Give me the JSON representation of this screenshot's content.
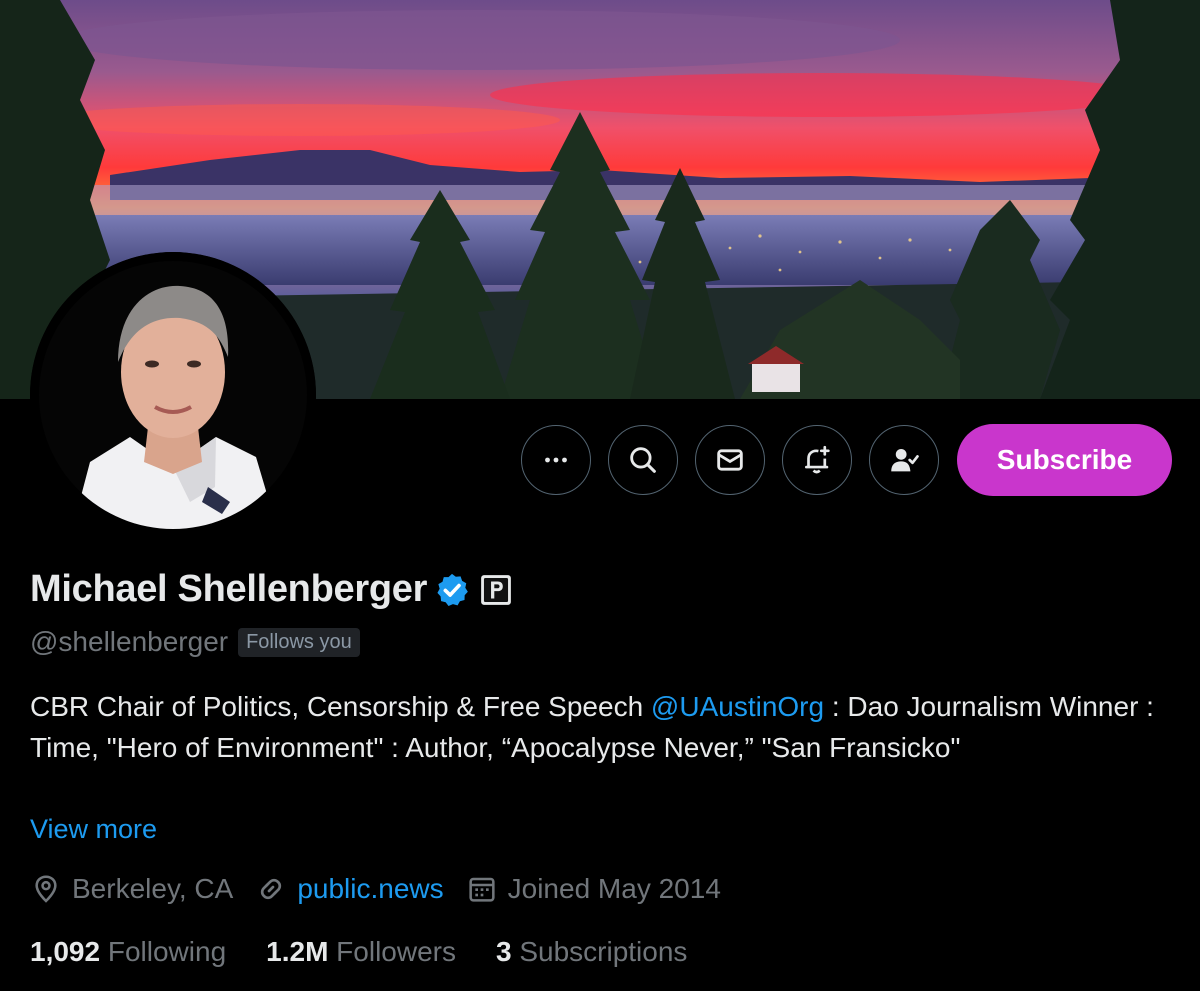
{
  "profile": {
    "display_name": "Michael Shellenberger",
    "handle": "@shellenberger",
    "follows_you": "Follows you",
    "bio_part1": "CBR Chair of Politics, Censorship & Free Speech ",
    "bio_mention": "@UAustinOrg",
    "bio_part2": " : Dao Journalism Winner : Time, \"Hero of Environment\" : Author, “Apocalypse Never,” \"San Fransicko\"",
    "view_more": "View more",
    "location": "Berkeley, CA",
    "website": "public.news",
    "joined": "Joined May 2014"
  },
  "stats": {
    "following_count": "1,092",
    "following_label": "Following",
    "followers_count": "1.2M",
    "followers_label": "Followers",
    "subscriptions_count": "3",
    "subscriptions_label": "Subscriptions"
  },
  "actions": {
    "more_icon": "more-icon",
    "search_icon": "search-icon",
    "message_icon": "mail-icon",
    "notify_icon": "bell-plus-icon",
    "following_icon": "person-check-icon",
    "subscribe_label": "Subscribe"
  },
  "colors": {
    "accent_link": "#1d9bf0",
    "subscribe": "#c936cc",
    "muted": "#71767b",
    "background": "#000000"
  }
}
